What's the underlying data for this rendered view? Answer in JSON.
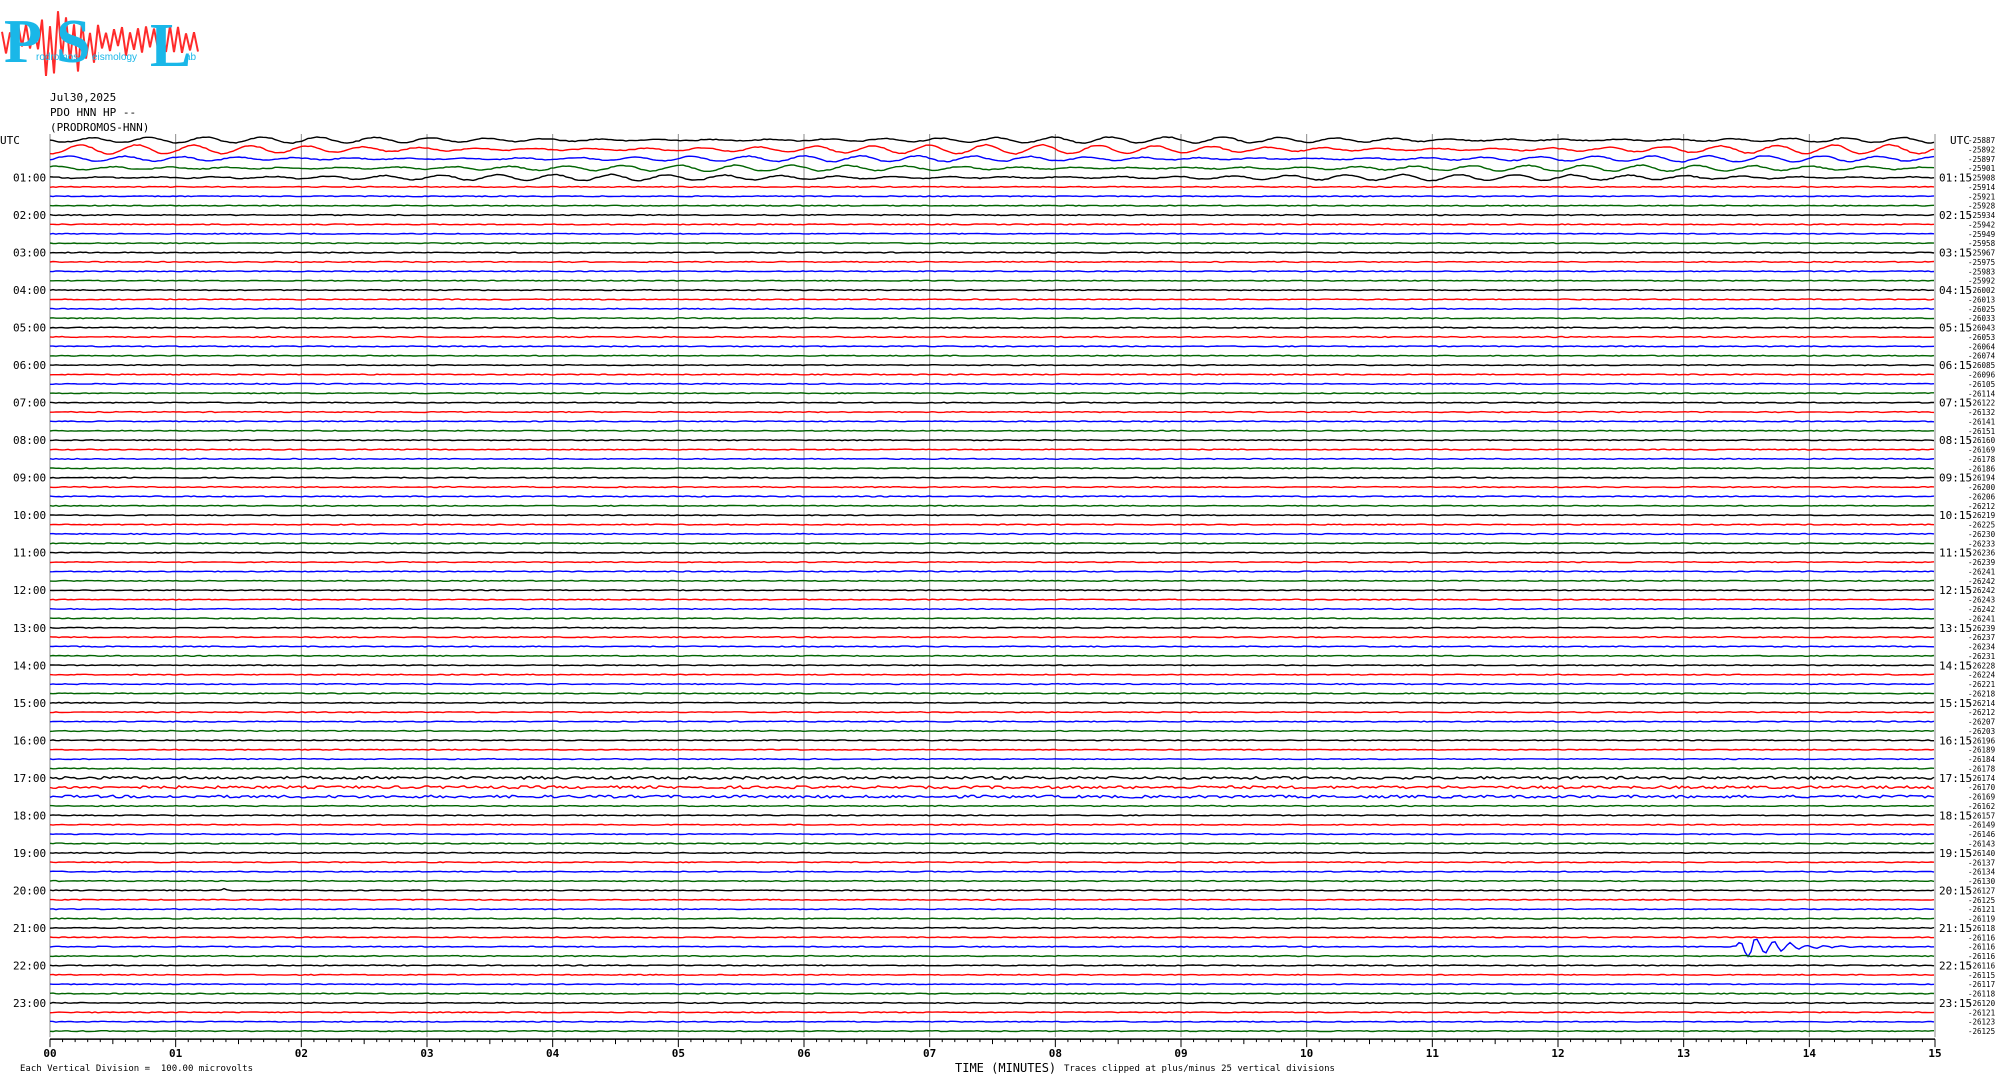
{
  "logo": {
    "letters": [
      "P",
      "S",
      "L"
    ],
    "small_text": [
      "rodromos",
      "eismology",
      "ab"
    ],
    "colors": {
      "letters": "#1ab7e8",
      "wave": "#ff2b2b"
    }
  },
  "header": {
    "date": "Jul30,2025",
    "station": "PDO HNN HP --",
    "site": "(PRODROMOS-HNN)"
  },
  "footer": {
    "scale_note": "Each Vertical Division =  100.00 microvolts",
    "xlabel": "TIME (MINUTES)",
    "clip_note": "Traces clipped at plus/minus 25 vertical divisions"
  },
  "chart_data": {
    "type": "line",
    "title": "",
    "xlabel": "TIME (MINUTES)",
    "xlim": [
      0,
      15
    ],
    "x_ticks": [
      "00",
      "01",
      "02",
      "03",
      "04",
      "05",
      "06",
      "07",
      "08",
      "09",
      "10",
      "11",
      "12",
      "13",
      "14",
      "15"
    ],
    "left_axis_title": "UTC",
    "right_axis_title": "UTC",
    "left_hour_labels": [
      "01:00",
      "02:00",
      "03:00",
      "04:00",
      "05:00",
      "06:00",
      "07:00",
      "08:00",
      "09:00",
      "10:00",
      "11:00",
      "12:00",
      "13:00",
      "14:00",
      "15:00",
      "16:00",
      "17:00",
      "18:00",
      "19:00",
      "20:00",
      "21:00",
      "22:00",
      "23:00"
    ],
    "right_hour_labels": [
      "01:15",
      "02:15",
      "03:15",
      "04:15",
      "05:15",
      "06:15",
      "07:15",
      "08:15",
      "09:15",
      "10:15",
      "11:15",
      "12:15",
      "13:15",
      "14:15",
      "15:15",
      "16:15",
      "17:15",
      "18:15",
      "19:15",
      "20:15",
      "21:15",
      "22:15",
      "23:15"
    ],
    "trace_colors": [
      "#000000",
      "#ff0000",
      "#0000ff",
      "#006400"
    ],
    "trace_count": 96,
    "trace_minutes": 15,
    "trace_offsets": [
      "-25887",
      "-25892",
      "-25897",
      "-25901",
      "-25908",
      "-25914",
      "-25921",
      "-25928",
      "-25934",
      "-25942",
      "-25949",
      "-25958",
      "-25967",
      "-25975",
      "-25983",
      "-25992",
      "-26002",
      "-26013",
      "-26025",
      "-26033",
      "-26043",
      "-26053",
      "-26064",
      "-26074",
      "-26085",
      "-26096",
      "-26105",
      "-26114",
      "-26122",
      "-26132",
      "-26141",
      "-26151",
      "-26160",
      "-26169",
      "-26178",
      "-26186",
      "-26194",
      "-26200",
      "-26206",
      "-26212",
      "-26219",
      "-26225",
      "-26230",
      "-26233",
      "-26236",
      "-26239",
      "-26241",
      "-26242",
      "-26242",
      "-26243",
      "-26242",
      "-26241",
      "-26239",
      "-26237",
      "-26234",
      "-26231",
      "-26228",
      "-26224",
      "-26221",
      "-26218",
      "-26214",
      "-26212",
      "-26207",
      "-26203",
      "-26196",
      "-26189",
      "-26184",
      "-26178",
      "-26174",
      "-26170",
      "-26169",
      "-26162",
      "-26157",
      "-26149",
      "-26146",
      "-26143",
      "-26140",
      "-26137",
      "-26134",
      "-26130",
      "-26127",
      "-26125",
      "-26121",
      "-26119",
      "-26118",
      "-26116",
      "-26116",
      "-26116",
      "-26116",
      "-26115",
      "-26117",
      "-26118",
      "-26120",
      "-26121",
      "-26123",
      "-26125"
    ],
    "microseisms": {
      "traces": [
        0,
        1,
        2,
        3,
        4
      ],
      "period_minutes": 0.45
    },
    "noisy_traces": [
      68,
      69,
      70
    ],
    "events": [
      {
        "trace": 80,
        "minute": 1.35,
        "amplitude": 3,
        "duration_minutes": 0.15
      },
      {
        "trace": 86,
        "minute": 13.4,
        "amplitude": 14,
        "duration_minutes": 1.0
      }
    ],
    "grid": true
  }
}
